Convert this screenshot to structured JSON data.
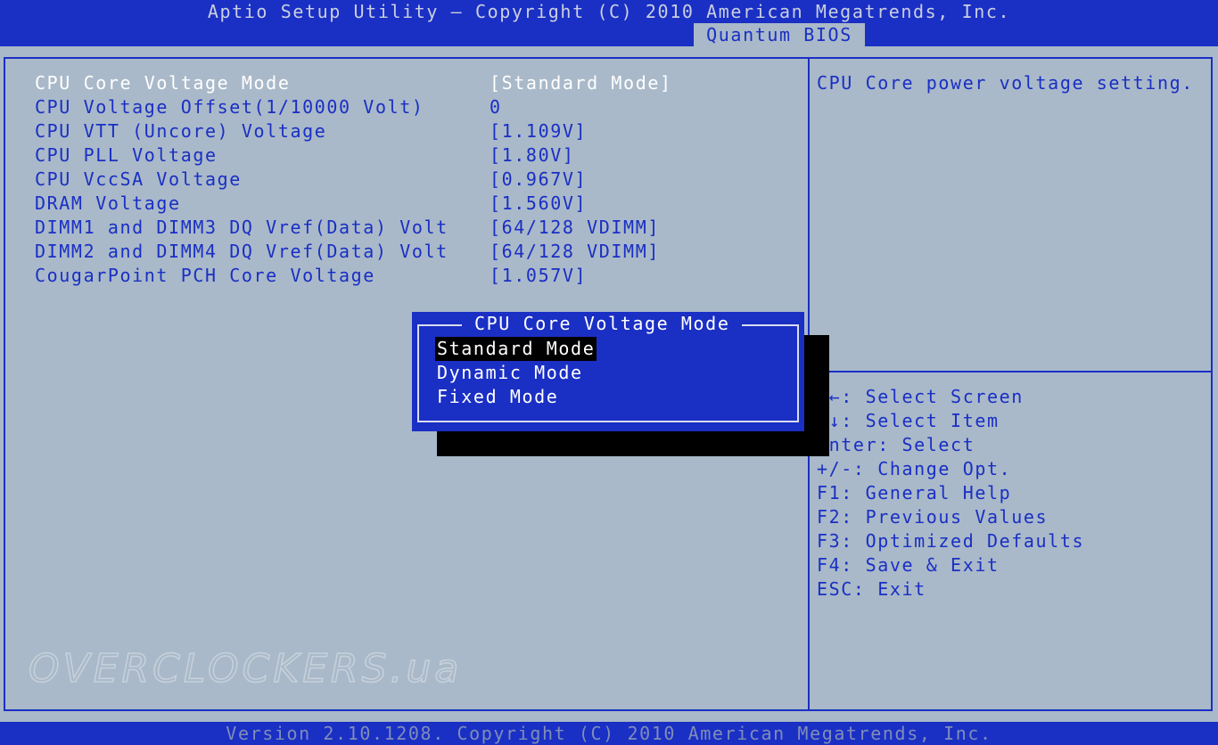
{
  "header": {
    "title": "Aptio Setup Utility – Copyright (C) 2010 American Megatrends, Inc.",
    "tab": "Quantum BIOS"
  },
  "settings": [
    {
      "label": "CPU Core Voltage Mode",
      "value": "[Standard Mode]"
    },
    {
      "label": "CPU Voltage Offset(1/10000 Volt)",
      "value": "0"
    },
    {
      "label": "CPU VTT (Uncore) Voltage",
      "value": "[1.109V]"
    },
    {
      "label": "CPU PLL Voltage",
      "value": "[1.80V]"
    },
    {
      "label": "CPU VccSA Voltage",
      "value": "[0.967V]"
    },
    {
      "label": "DRAM Voltage",
      "value": "[1.560V]"
    },
    {
      "label": "DIMM1 and DIMM3 DQ Vref(Data) Volt",
      "value": "[64/128 VDIMM]"
    },
    {
      "label": "DIMM2 and DIMM4 DQ Vref(Data) Volt",
      "value": "[64/128 VDIMM]"
    },
    {
      "label": "CougarPoint PCH Core Voltage",
      "value": "[1.057V]"
    }
  ],
  "help": {
    "text": "CPU Core power voltage setting."
  },
  "keys": [
    "→←: Select Screen",
    "↑↓: Select Item",
    "Enter: Select",
    "+/-: Change Opt.",
    "F1: General Help",
    "F2: Previous Values",
    "F3: Optimized Defaults",
    "F4: Save & Exit",
    "ESC: Exit"
  ],
  "popup": {
    "title": "CPU Core Voltage Mode",
    "options": [
      "Standard Mode",
      "Dynamic Mode",
      "Fixed Mode"
    ],
    "selected": "Standard Mode"
  },
  "footer": {
    "text": "Version 2.10.1208. Copyright (C) 2010 American Megatrends, Inc."
  },
  "watermark": "OVERCLOCKERS.ua",
  "colors": {
    "background": "#a9b9c9",
    "accent": "#1a2fc4",
    "highlight_text": "#ffffff",
    "selection_bg": "#000000"
  }
}
